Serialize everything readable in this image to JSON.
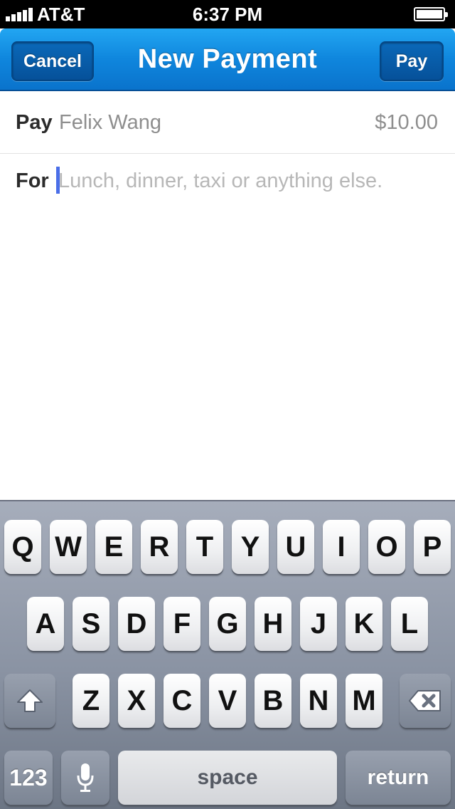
{
  "status_bar": {
    "carrier": "AT&T",
    "time": "6:37 PM"
  },
  "nav": {
    "title": "New Payment",
    "cancel_label": "Cancel",
    "pay_label": "Pay",
    "accent_color": "#0f86dd"
  },
  "form": {
    "pay_label": "Pay",
    "payee": "Felix Wang",
    "amount": "$10.00",
    "for_label": "For",
    "for_placeholder": "Lunch, dinner, taxi or anything else."
  },
  "keyboard": {
    "row1": [
      "Q",
      "W",
      "E",
      "R",
      "T",
      "Y",
      "U",
      "I",
      "O",
      "P"
    ],
    "row2": [
      "A",
      "S",
      "D",
      "F",
      "G",
      "H",
      "J",
      "K",
      "L"
    ],
    "row3": [
      "Z",
      "X",
      "C",
      "V",
      "B",
      "N",
      "M"
    ],
    "num_label": "123",
    "space_label": "space",
    "return_label": "return",
    "icons": [
      "shift-icon",
      "delete-icon",
      "microphone-icon"
    ]
  }
}
